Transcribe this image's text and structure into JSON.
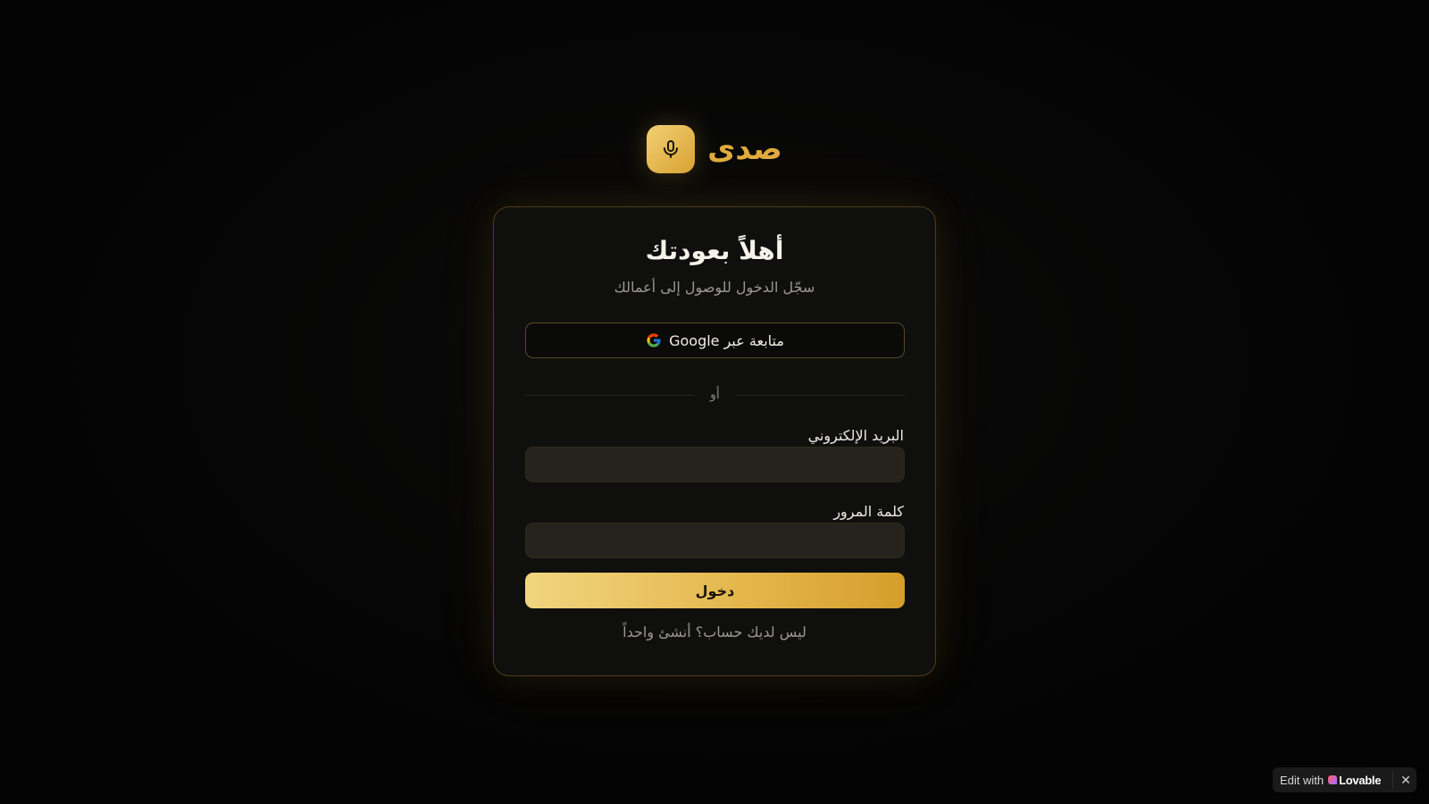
{
  "brand": {
    "name": "صدى",
    "logo_icon": "microphone-icon"
  },
  "login": {
    "title": "أهلاً بعودتك",
    "subtitle": "سجّل الدخول للوصول إلى أعمالك",
    "google_button": "متابعة عبر Google",
    "divider_text": "أو",
    "email_label": "البريد الإلكتروني",
    "email_value": "",
    "password_label": "كلمة المرور",
    "password_value": "",
    "submit_label": "دخول",
    "signup_link": "ليس لديك حساب؟ أنشئ واحداً"
  },
  "badge": {
    "edit_label": "Edit with",
    "brand_label": "Lovable",
    "close_icon": "close-icon"
  },
  "colors": {
    "accent": "#e0ab3e",
    "background": "#050505",
    "card": "#0f0f0e",
    "input": "#25231b"
  }
}
